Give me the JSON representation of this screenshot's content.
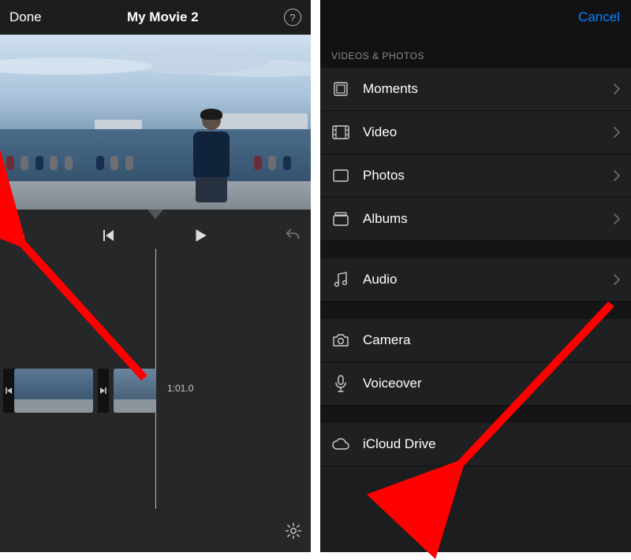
{
  "left": {
    "done": "Done",
    "title": "My Movie 2",
    "timecode": "1:01.0"
  },
  "right": {
    "cancel": "Cancel",
    "section_header": "VIDEOS & PHOTOS",
    "items": {
      "moments": {
        "label": "Moments",
        "chevron": true
      },
      "video": {
        "label": "Video",
        "chevron": true
      },
      "photos": {
        "label": "Photos",
        "chevron": true
      },
      "albums": {
        "label": "Albums",
        "chevron": true
      },
      "audio": {
        "label": "Audio",
        "chevron": true
      },
      "camera": {
        "label": "Camera",
        "chevron": false
      },
      "voiceover": {
        "label": "Voiceover",
        "chevron": false
      },
      "icloud": {
        "label": "iCloud Drive",
        "chevron": false
      }
    }
  },
  "colors": {
    "accent": "#0a84ff",
    "arrow": "#ff0000"
  }
}
